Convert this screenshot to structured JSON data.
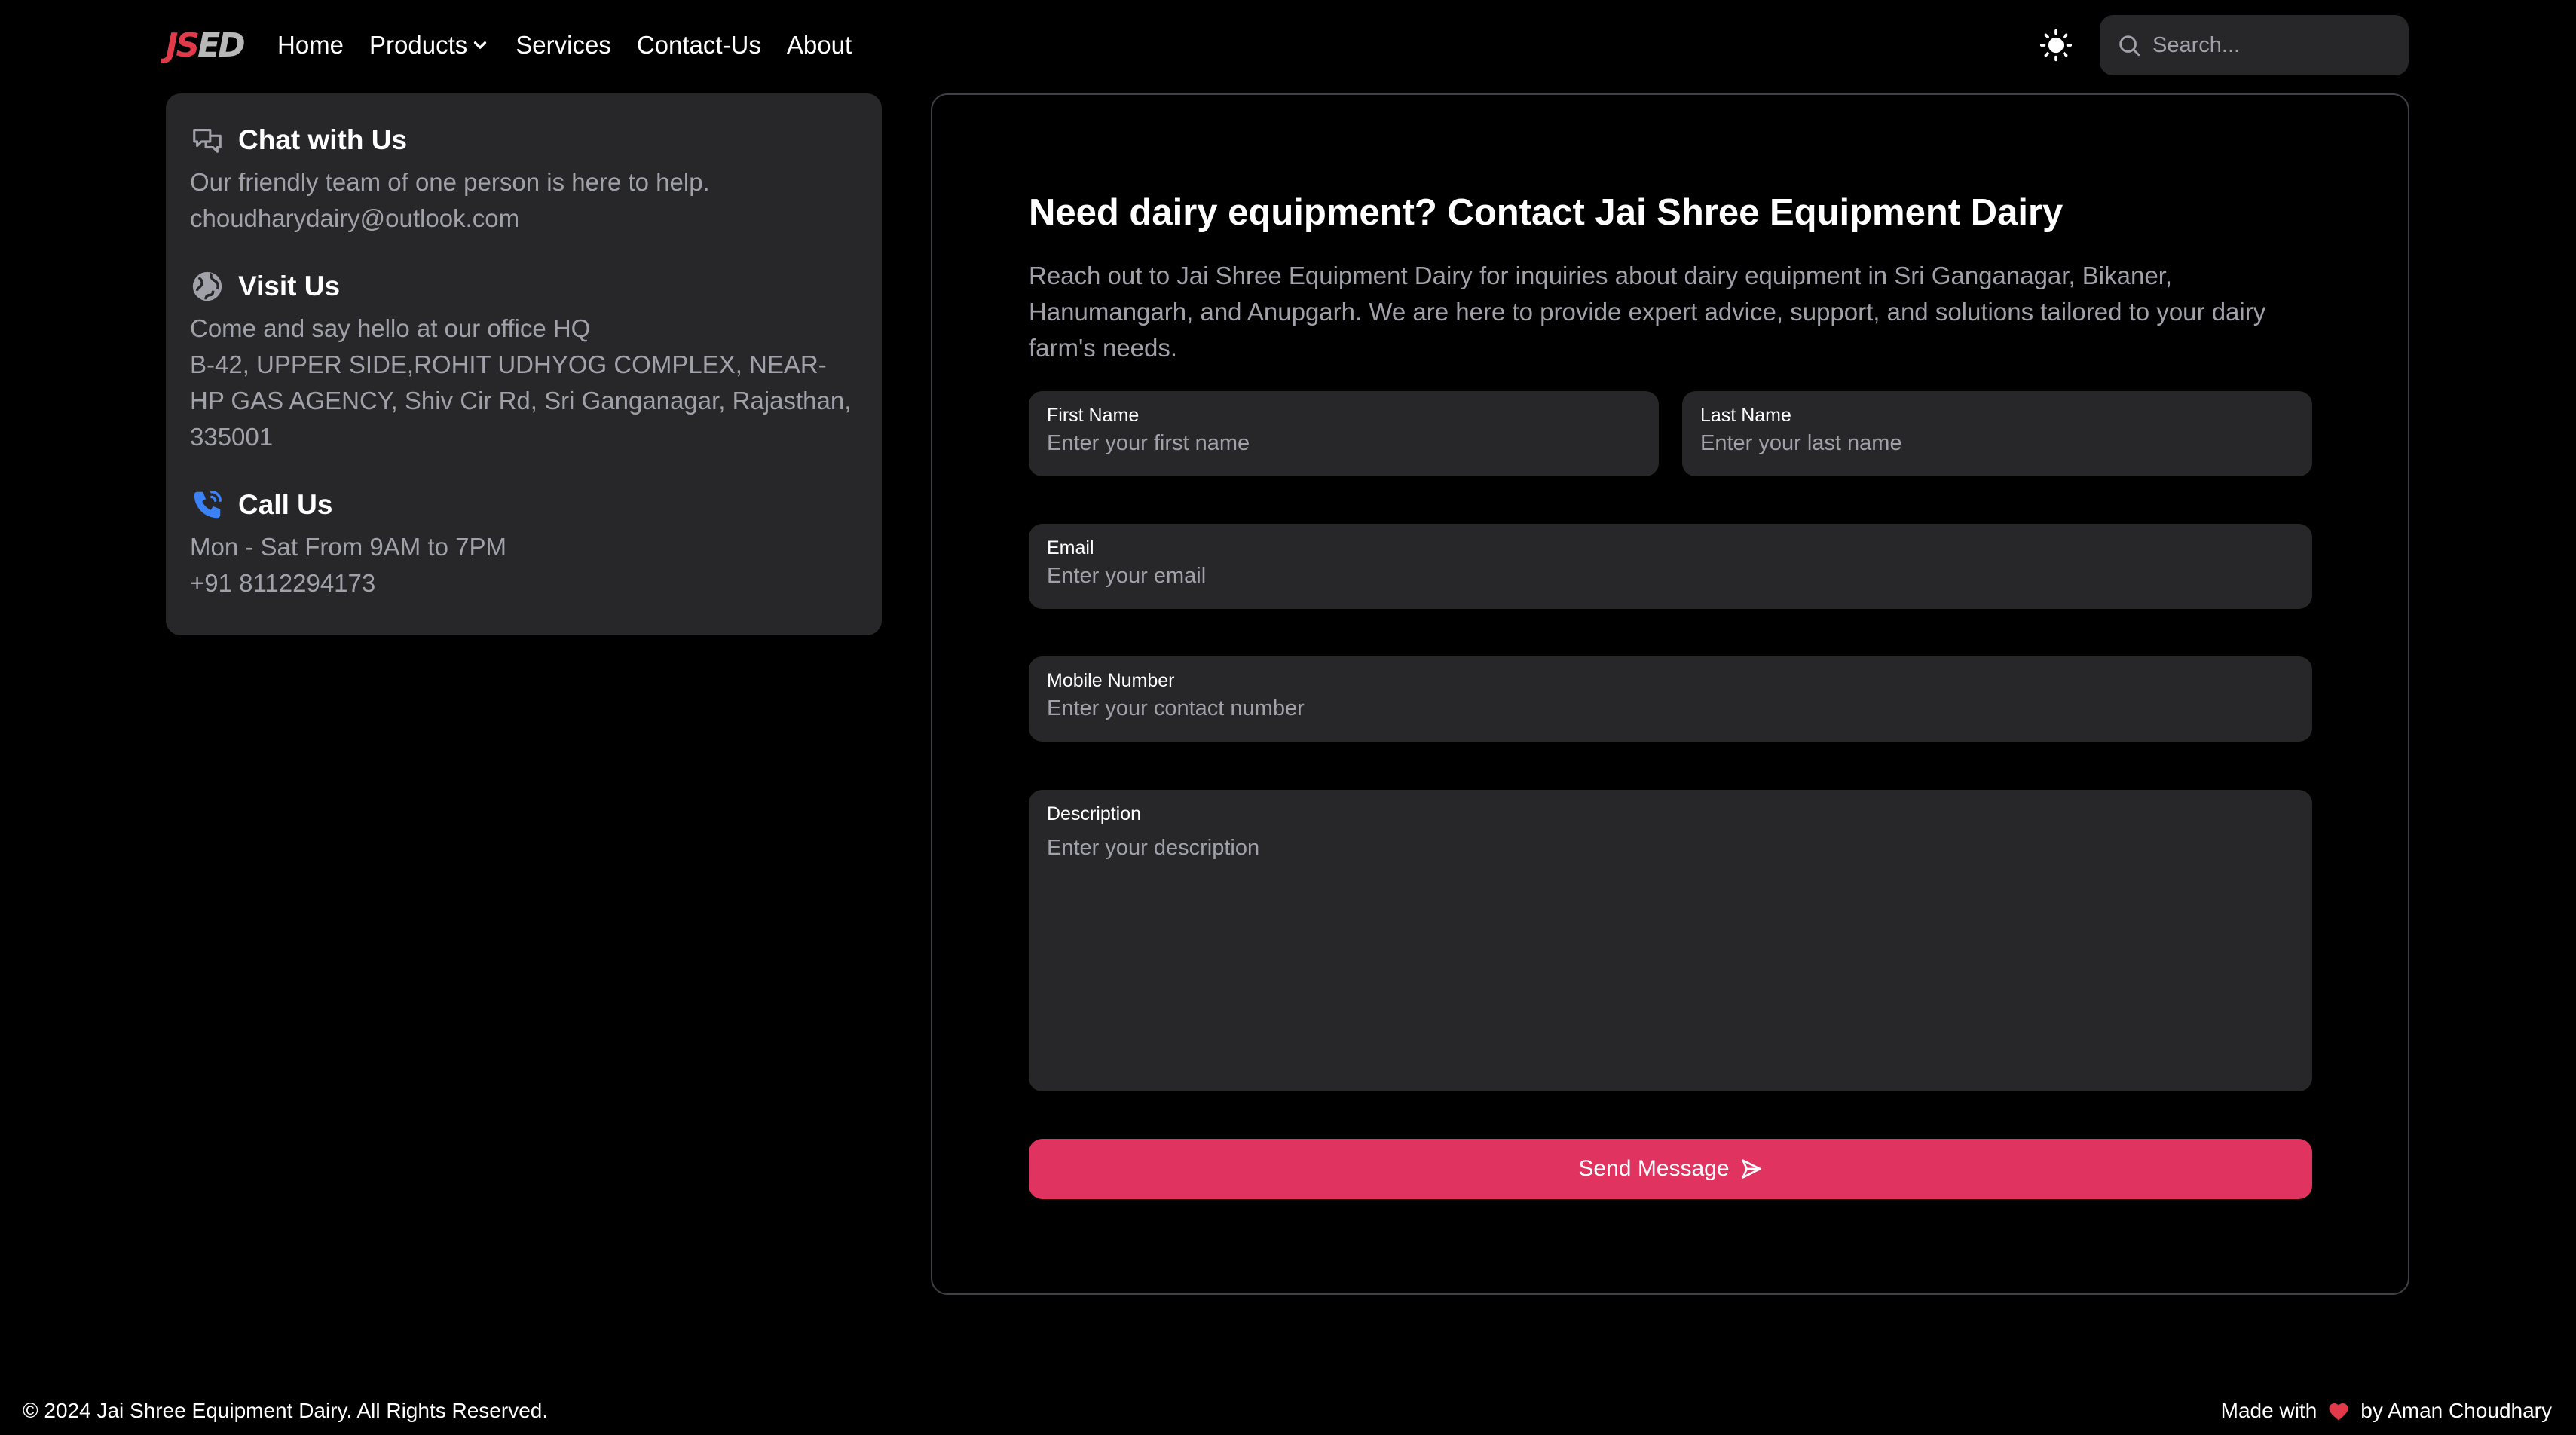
{
  "nav": {
    "logo_part1": "JS",
    "logo_part2": "ED",
    "links": [
      "Home",
      "Products",
      "Services",
      "Contact-Us",
      "About"
    ],
    "search_placeholder": "Search..."
  },
  "info": {
    "chat": {
      "title": "Chat with Us",
      "line1": "Our friendly team of one person is here to help.",
      "line2": "choudharydairy@outlook.com"
    },
    "visit": {
      "title": "Visit Us",
      "line1": "Come and say hello at our office HQ",
      "line2": "B-42, UPPER SIDE,ROHIT UDHYOG COMPLEX, NEAR-HP GAS AGENCY, Shiv Cir Rd, Sri Ganganagar, Rajasthan, 335001"
    },
    "call": {
      "title": "Call Us",
      "line1": "Mon - Sat From 9AM to 7PM",
      "line2": "+91 8112294173"
    }
  },
  "form": {
    "title": "Need dairy equipment? Contact Jai Shree Equipment Dairy",
    "description": "Reach out to Jai Shree Equipment Dairy for inquiries about dairy equipment in Sri Ganganagar, Bikaner, Hanumangarh, and Anupgarh. We are here to provide expert advice, support, and solutions tailored to your dairy farm's needs.",
    "first_name": {
      "label": "First Name",
      "placeholder": "Enter your first name"
    },
    "last_name": {
      "label": "Last Name",
      "placeholder": "Enter your last name"
    },
    "email": {
      "label": "Email",
      "placeholder": "Enter your email"
    },
    "mobile": {
      "label": "Mobile Number",
      "placeholder": "Enter your contact number"
    },
    "desc": {
      "label": "Description",
      "placeholder": "Enter your description"
    },
    "submit_label": "Send Message"
  },
  "footer": {
    "copyright": "© 2024 Jai Shree Equipment Dairy. All Rights Reserved.",
    "made_with": "Made with",
    "by": "by Aman Choudhary"
  },
  "colors": {
    "background": "#000000",
    "card": "#27272a",
    "accent": "#e0335f",
    "muted_text": "#a1a1aa"
  }
}
